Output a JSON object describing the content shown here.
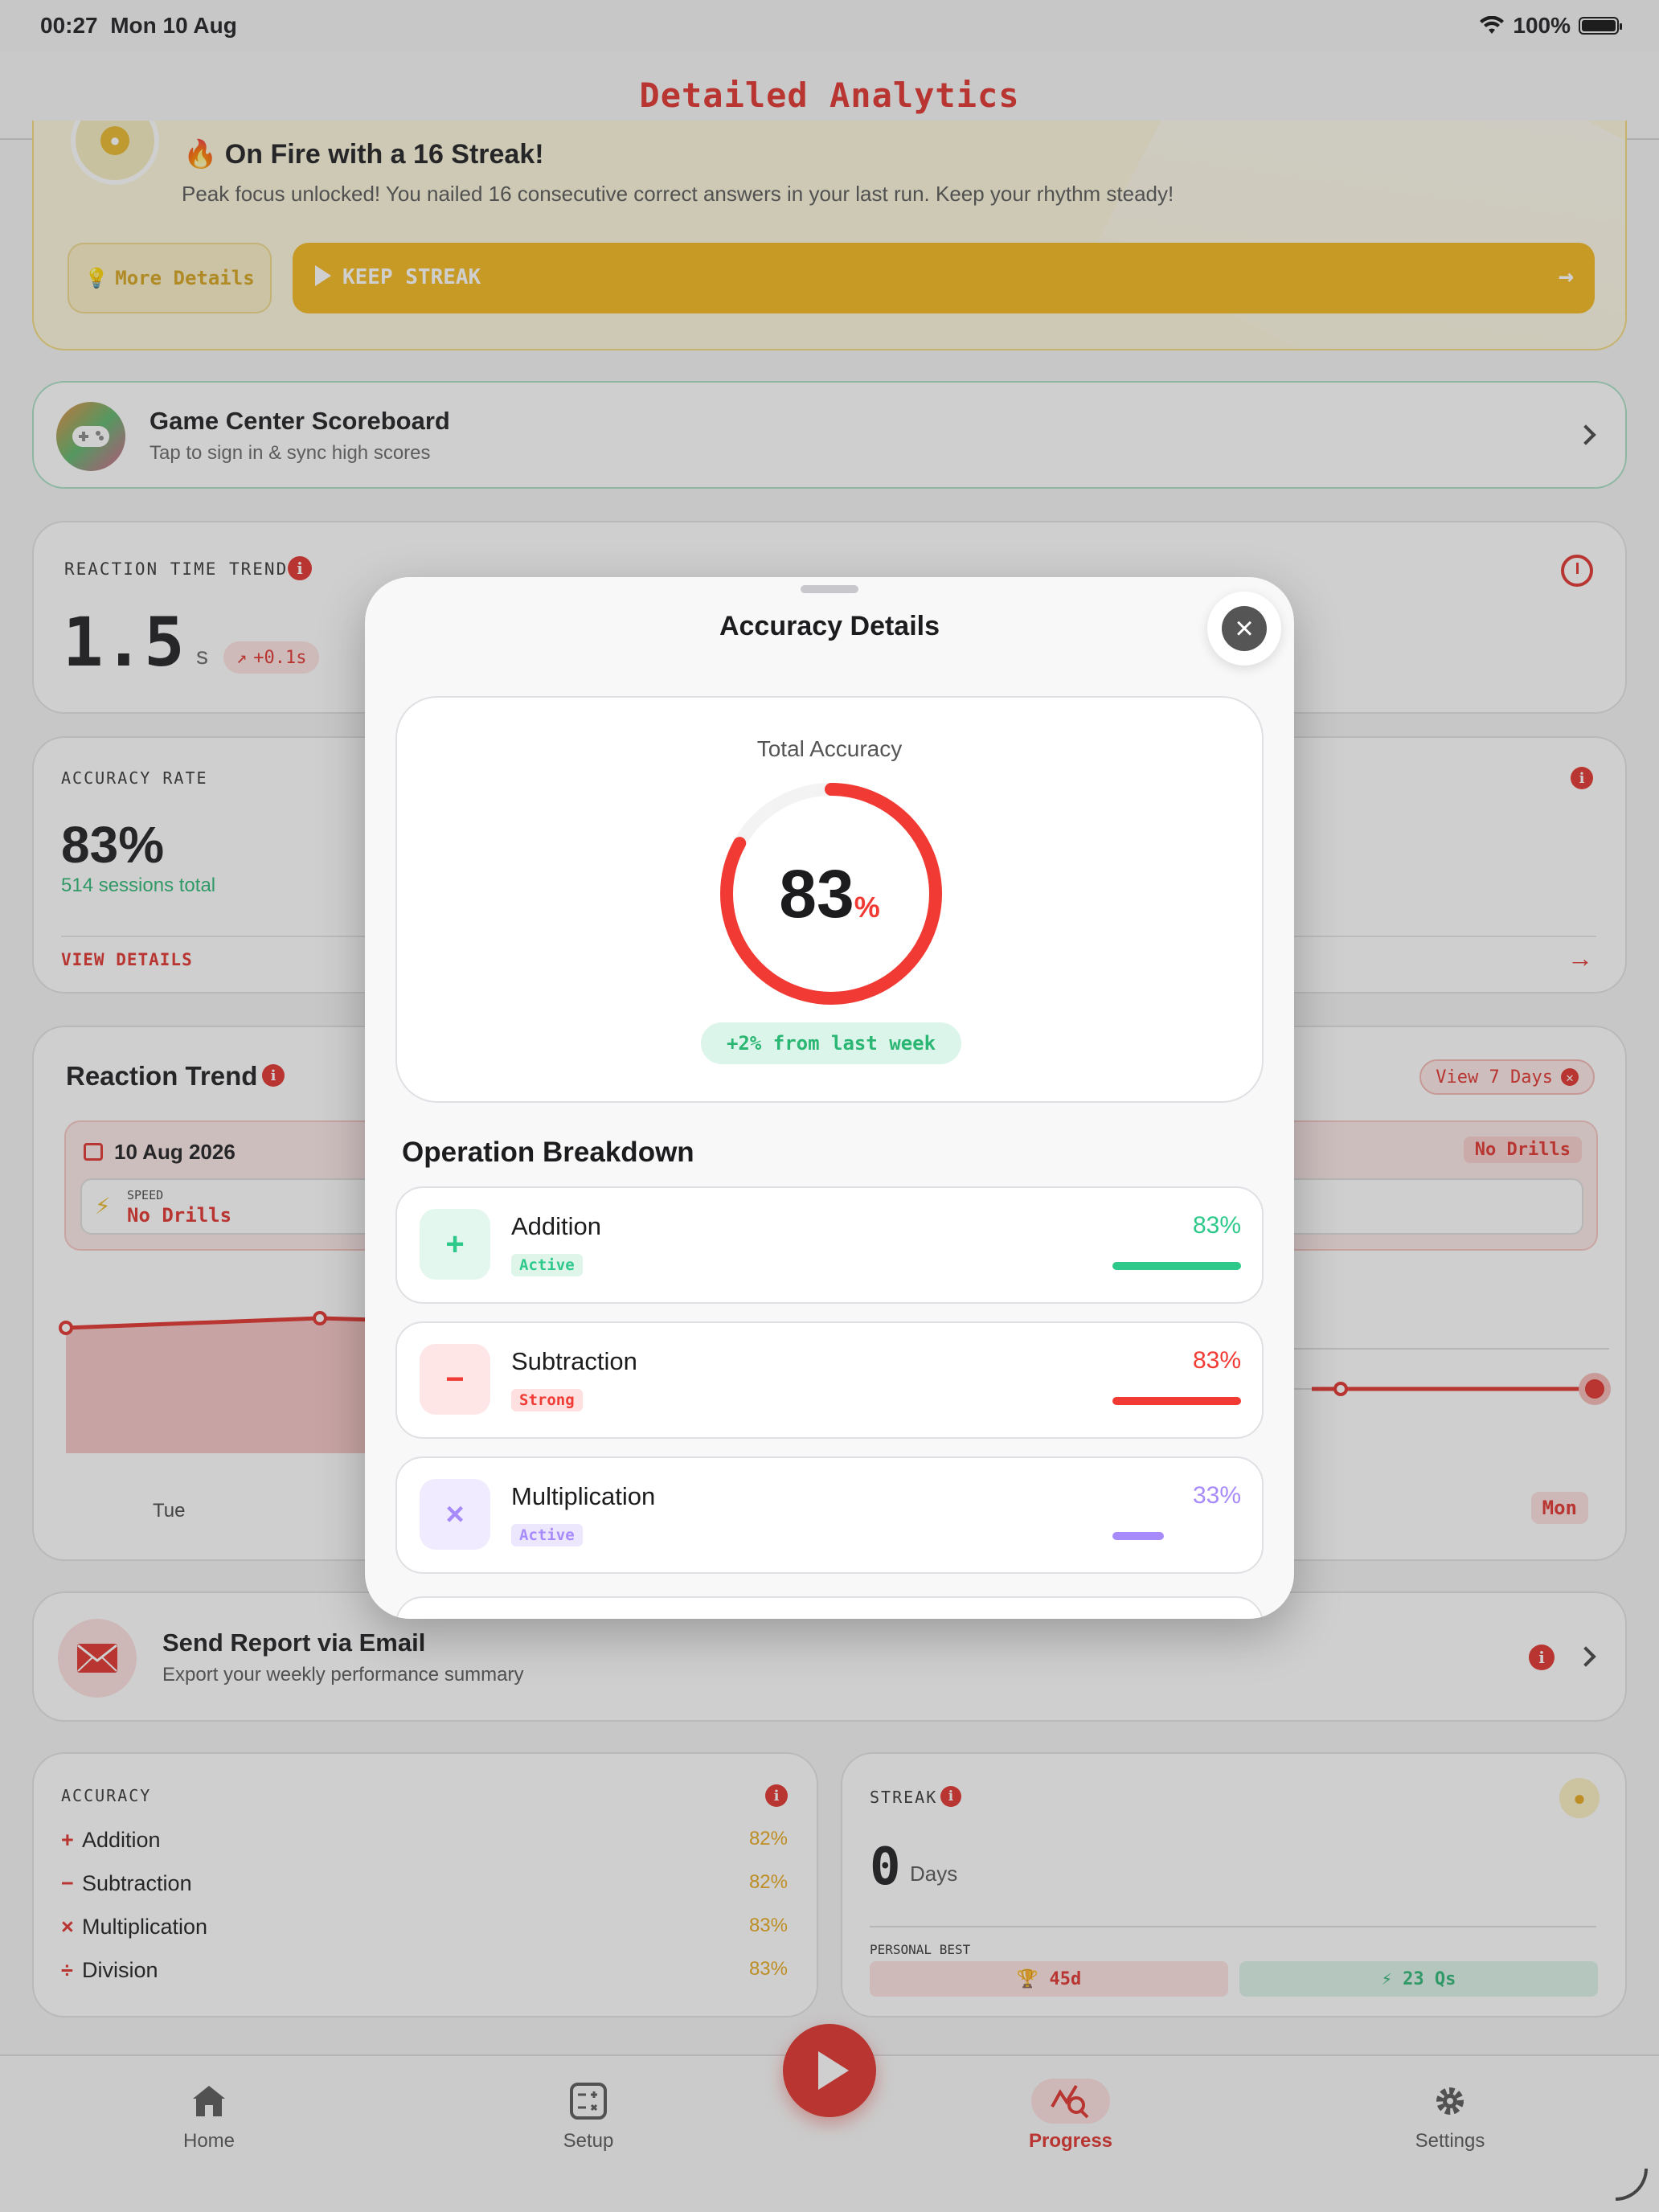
{
  "status": {
    "time": "00:27",
    "date": "Mon 10 Aug",
    "battery": "100%"
  },
  "nav": {
    "title": "Detailed Analytics"
  },
  "streak_banner": {
    "title": "🔥 On Fire with a 16 Streak!",
    "text": "Peak focus unlocked! You nailed 16 consecutive correct answers in your last run. Keep your rhythm steady!",
    "more_label": "More Details",
    "keep_label": "KEEP STREAK"
  },
  "game_center": {
    "title": "Game Center Scoreboard",
    "subtitle": "Tap to sign in & sync high scores"
  },
  "reaction_time": {
    "label": "REACTION TIME TREND",
    "value": "1.5",
    "unit": "s",
    "delta": "+0.1s"
  },
  "accuracy_rate": {
    "label": "ACCURACY RATE",
    "value": "83%",
    "sessions": "514 sessions total",
    "link": "VIEW DETAILS"
  },
  "reaction_trend": {
    "title": "Reaction Trend",
    "view_days": "View 7 Days",
    "date": "10 Aug 2026",
    "no_drills_badge": "No Drills",
    "speed_label": "SPEED",
    "speed_value": "No Drills",
    "day_first": "Tue",
    "day_last": "Mon"
  },
  "email": {
    "title": "Send Report via Email",
    "subtitle": "Export your weekly performance summary"
  },
  "accuracy_card": {
    "label": "ACCURACY",
    "rows": [
      {
        "sym": "+",
        "name": "Addition",
        "pct": "82%"
      },
      {
        "sym": "−",
        "name": "Subtraction",
        "pct": "82%"
      },
      {
        "sym": "×",
        "name": "Multiplication",
        "pct": "83%"
      },
      {
        "sym": "÷",
        "name": "Division",
        "pct": "83%"
      }
    ]
  },
  "streak_card": {
    "label": "STREAK",
    "value": "0",
    "unit": "Days",
    "best_label": "PERSONAL BEST",
    "best_days": "🏆 45d",
    "best_qs": "⚡ 23 Qs"
  },
  "modal": {
    "title": "Accuracy Details",
    "total_label": "Total Accuracy",
    "total_value": "83",
    "total_unit": "%",
    "total_fraction": 0.83,
    "change": "+2% from last week",
    "breakdown_title": "Operation Breakdown",
    "ops": [
      {
        "icon": "+",
        "name": "Addition",
        "badge": "Active",
        "pct": "83%",
        "fraction": 0.83,
        "color": "#2ec98a",
        "bg": "#e3f7ef",
        "badge_bg": "#dff5ea"
      },
      {
        "icon": "−",
        "name": "Subtraction",
        "badge": "Strong",
        "pct": "83%",
        "fraction": 0.83,
        "color": "#f03a33",
        "bg": "#fde6e5",
        "badge_bg": "#fde0df"
      },
      {
        "icon": "×",
        "name": "Multiplication",
        "badge": "Active",
        "pct": "33%",
        "fraction": 0.33,
        "color": "#a78bfa",
        "bg": "#f0ebfe",
        "badge_bg": "#ede7fd"
      }
    ]
  },
  "tabs": [
    {
      "label": "Home",
      "icon": "house-icon"
    },
    {
      "label": "Setup",
      "icon": "calculator-icon"
    },
    {
      "label": "Progress",
      "icon": "chart-search-icon"
    },
    {
      "label": "Settings",
      "icon": "gear-icon"
    }
  ]
}
